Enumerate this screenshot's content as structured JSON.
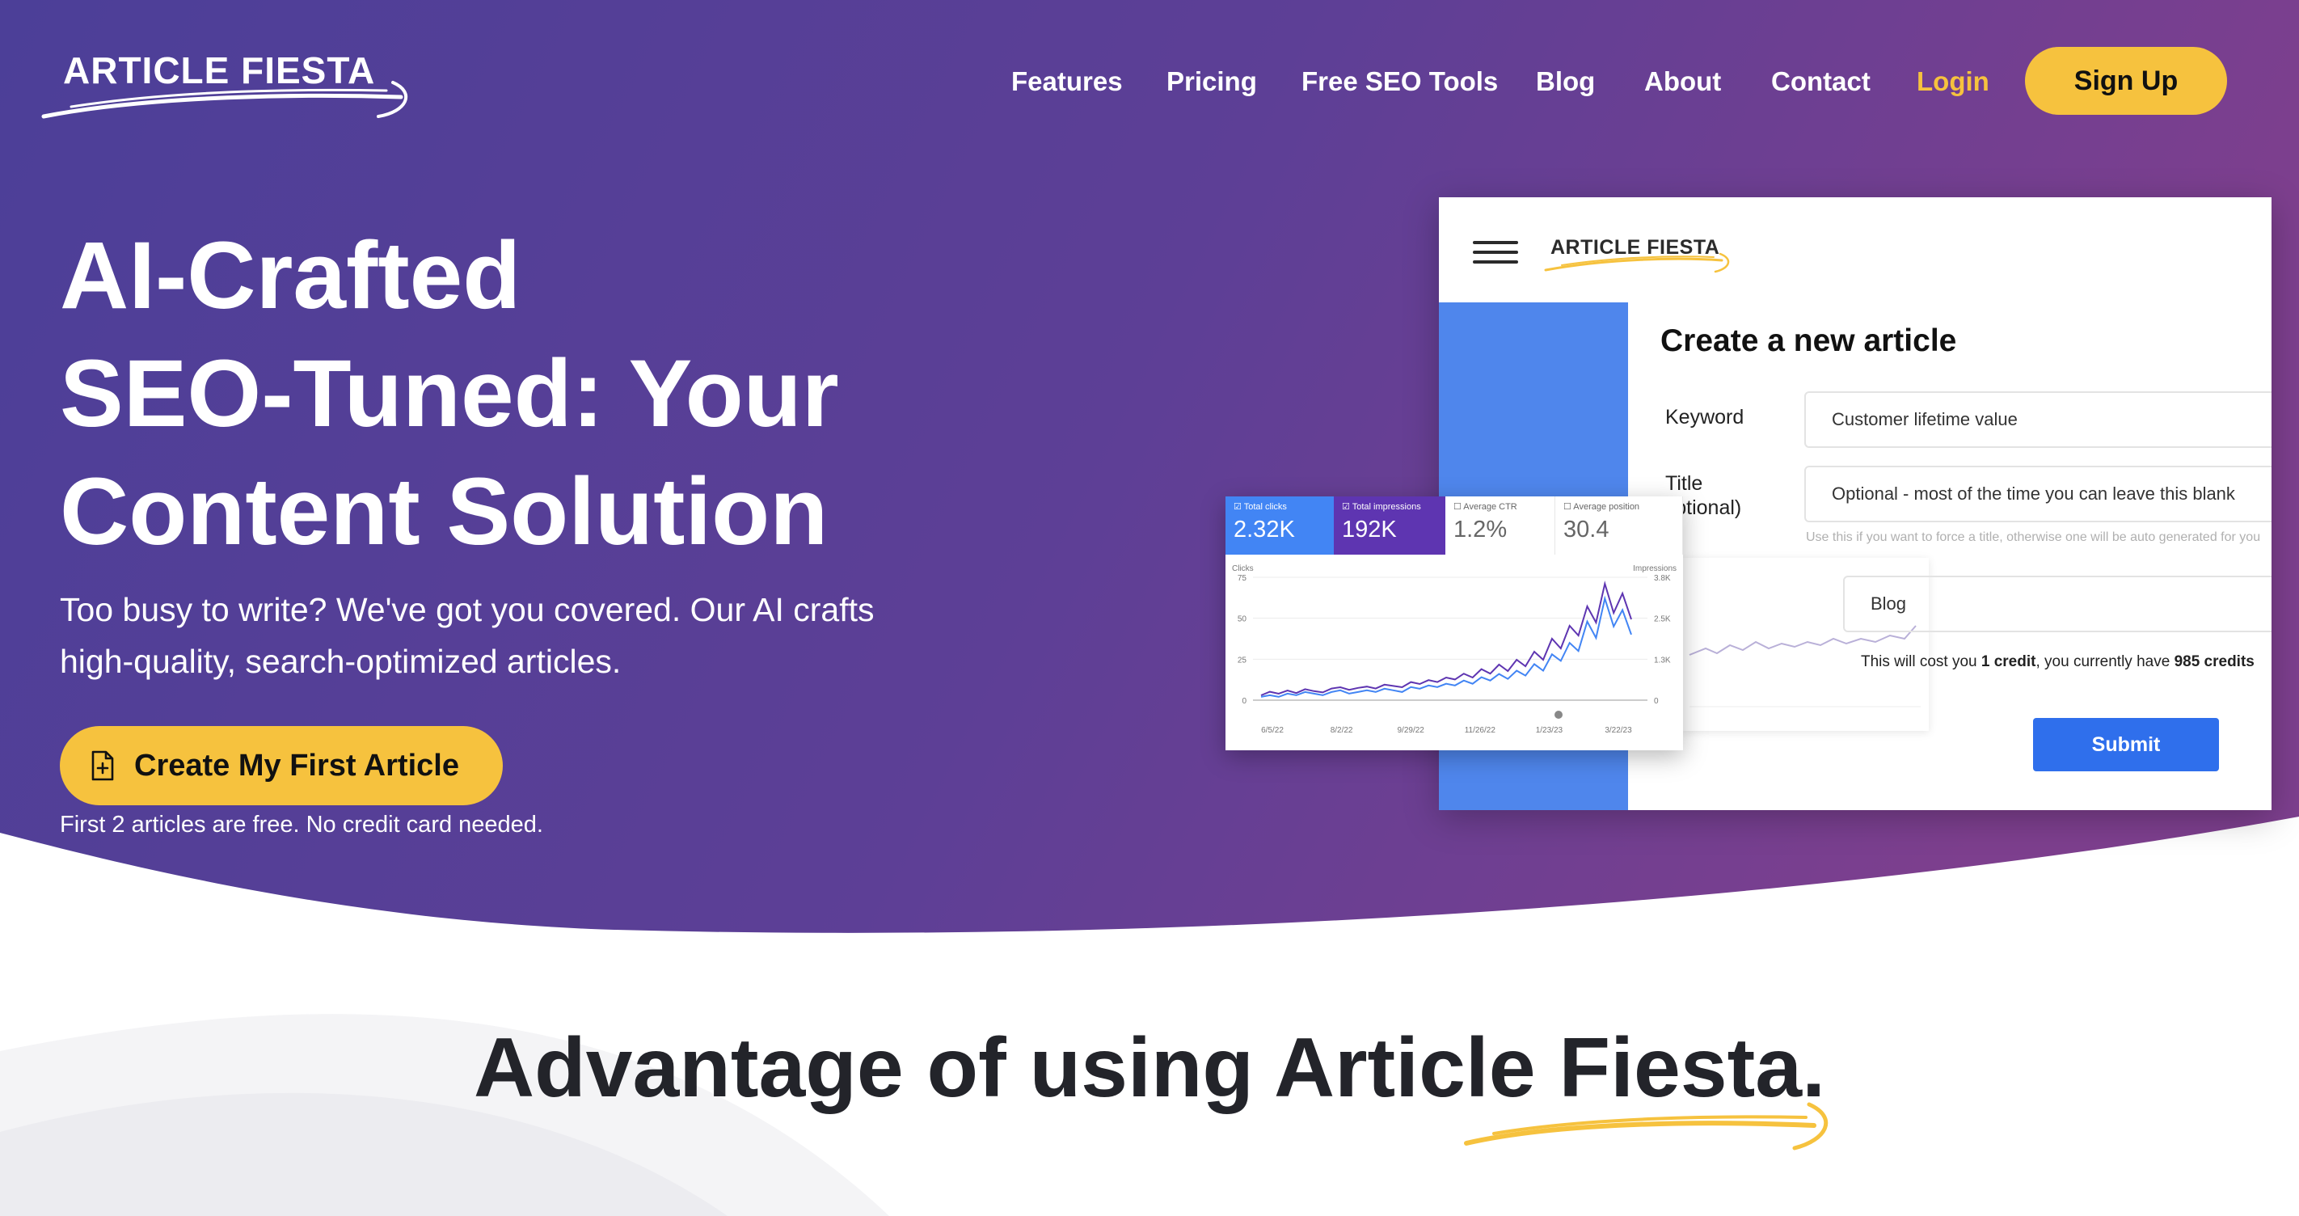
{
  "brand": {
    "name": "ARTICLE FIESTA",
    "colors": {
      "purple_start": "#4c3f98",
      "purple_end": "#7a3f8e",
      "accent_yellow": "#f6c23e",
      "blue": "#4f86ec"
    }
  },
  "nav": {
    "links": [
      {
        "label": "Features"
      },
      {
        "label": "Pricing"
      },
      {
        "label": "Free SEO Tools"
      },
      {
        "label": "Blog"
      },
      {
        "label": "About"
      },
      {
        "label": "Contact"
      }
    ],
    "login_label": "Login",
    "signup_label": "Sign Up"
  },
  "hero": {
    "title_lines": [
      "AI-Crafted",
      "SEO-Tuned: Your",
      "Content Solution"
    ],
    "subtitle": "Too busy to write? We've got you covered. Our AI crafts high-quality, search-optimized articles.",
    "cta_label": "Create My First Article",
    "cta_icon": "document-plus-icon",
    "note": "First 2 articles are free. No credit card needed."
  },
  "mockup": {
    "logo": "ARTICLE FIESTA",
    "heading": "Create a new article",
    "keyword_label": "Keyword",
    "keyword_value": "Customer lifetime value",
    "title_label_1": "Title",
    "title_label_2": "(optional)",
    "title_value": "Optional - most of the time you can leave this blank",
    "title_hint": "Use this if you want to force a title, otherwise one will be auto generated for you",
    "type_value": "Blog",
    "cost_prefix": "This will cost you ",
    "cost_credit": "1 credit",
    "cost_mid": ", you currently have ",
    "cost_total": "985 credits",
    "submit_label": "Submit"
  },
  "analytics": {
    "metrics": [
      {
        "label": "Total clicks",
        "value": "2.32K",
        "checked": true,
        "bg": "#4285f4"
      },
      {
        "label": "Total impressions",
        "value": "192K",
        "checked": true,
        "bg": "#5e35b1"
      },
      {
        "label": "Average CTR",
        "value": "1.2%",
        "checked": false,
        "bg": "#ffffff"
      },
      {
        "label": "Average position",
        "value": "30.4",
        "checked": false,
        "bg": "#ffffff"
      }
    ],
    "chart_data": {
      "type": "line",
      "xlabel": "",
      "ylabel": "Clicks",
      "y2label": "Impressions",
      "categories": [
        "6/5/22",
        "8/2/22",
        "9/29/22",
        "11/26/22",
        "1/23/23",
        "3/22/23"
      ],
      "ylim": [
        0,
        75
      ],
      "y_ticks": [
        "75",
        "50",
        "25",
        "0"
      ],
      "y2lim": [
        0,
        3800
      ],
      "y2_ticks": [
        "3.8K",
        "2.5K",
        "1.3K",
        "0"
      ],
      "series": [
        {
          "color": "#4285f4",
          "values": [
            2,
            3,
            2,
            4,
            3,
            5,
            4,
            3,
            5,
            6,
            4,
            5,
            6,
            5,
            7,
            6,
            5,
            8,
            7,
            9,
            8,
            10,
            9,
            12,
            10,
            14,
            12,
            16,
            13,
            18,
            15,
            22,
            18,
            28,
            24,
            35,
            30,
            48,
            38,
            62,
            45,
            55,
            40
          ]
        },
        {
          "color": "#5e35b1",
          "values": [
            150,
            260,
            200,
            300,
            220,
            340,
            280,
            240,
            360,
            400,
            320,
            380,
            420,
            360,
            480,
            440,
            400,
            560,
            500,
            620,
            560,
            700,
            640,
            820,
            700,
            960,
            820,
            1100,
            900,
            1250,
            1050,
            1500,
            1250,
            1900,
            1600,
            2300,
            2000,
            2900,
            2400,
            3600,
            2700,
            3300,
            2500
          ]
        }
      ]
    }
  },
  "advantages": {
    "title": "Advantage of using Article Fiesta."
  }
}
